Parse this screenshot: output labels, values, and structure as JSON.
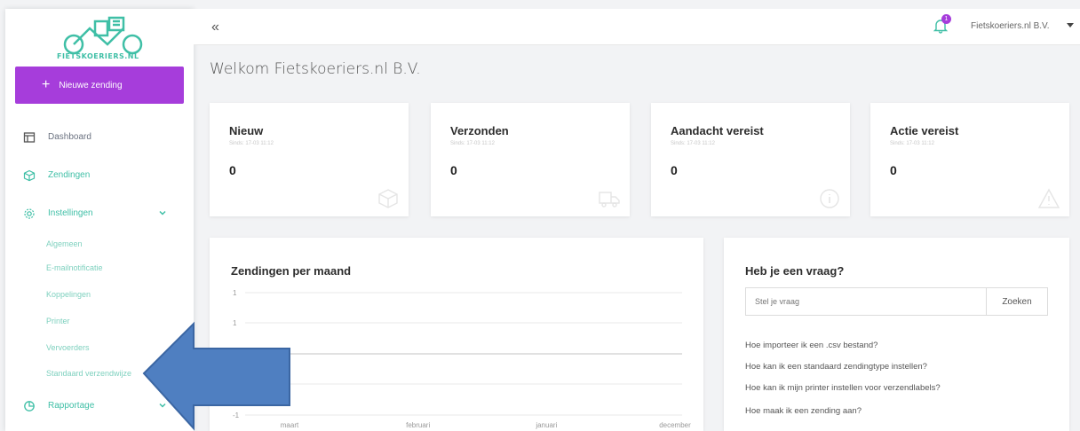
{
  "brand": {
    "logo_text": "FIETSKOERIERS.NL",
    "accent": "#a63ddb",
    "green": "#3fbfa6"
  },
  "sidebar": {
    "new_button": "Nieuwe zending",
    "items": [
      {
        "label": "Dashboard",
        "icon": "layout-icon"
      },
      {
        "label": "Zendingen",
        "icon": "package-icon"
      },
      {
        "label": "Instellingen",
        "icon": "gear-icon"
      },
      {
        "label": "Rapportage",
        "icon": "pie-chart-icon"
      }
    ],
    "settings_sub": [
      "Algemeen",
      "E-mailnotificatie",
      "Koppelingen",
      "Printer",
      "Vervoerders",
      "Standaard verzendwijze"
    ]
  },
  "header": {
    "collapse": "«",
    "notifications": "1",
    "user": "Fietskoeriers.nl B.V."
  },
  "welcome": "Welkom Fietskoeriers.nl B.V.",
  "cards": [
    {
      "title": "Nieuw",
      "since": "Sinds: 17-03 11:12",
      "count": "0",
      "icon": "box-icon"
    },
    {
      "title": "Verzonden",
      "since": "Sinds: 17-03 11:12",
      "count": "0",
      "icon": "truck-icon"
    },
    {
      "title": "Aandacht vereist",
      "since": "Sinds: 17-03 11:12",
      "count": "0",
      "icon": "info-icon"
    },
    {
      "title": "Actie vereist",
      "since": "Sinds: 17-03 11:12",
      "count": "0",
      "icon": "warning-icon"
    }
  ],
  "chart_data": {
    "type": "line",
    "title": "Zendingen per maand",
    "categories": [
      "maart",
      "februari",
      "januari",
      "december"
    ],
    "values": [
      0,
      0,
      0,
      0
    ],
    "ytick_labels": [
      "1",
      "1",
      "",
      "",
      "-1"
    ],
    "xlabel": "",
    "ylabel": ""
  },
  "faq": {
    "title": "Heb je een vraag?",
    "placeholder": "Stel je vraag",
    "button": "Zoeken",
    "links": [
      "Hoe importeer ik een .csv bestand?",
      "Hoe kan ik een standaard zendingtype instellen?",
      "Hoe kan ik mijn printer instellen voor verzendlabels?",
      "Hoe maak ik een zending aan?"
    ]
  }
}
